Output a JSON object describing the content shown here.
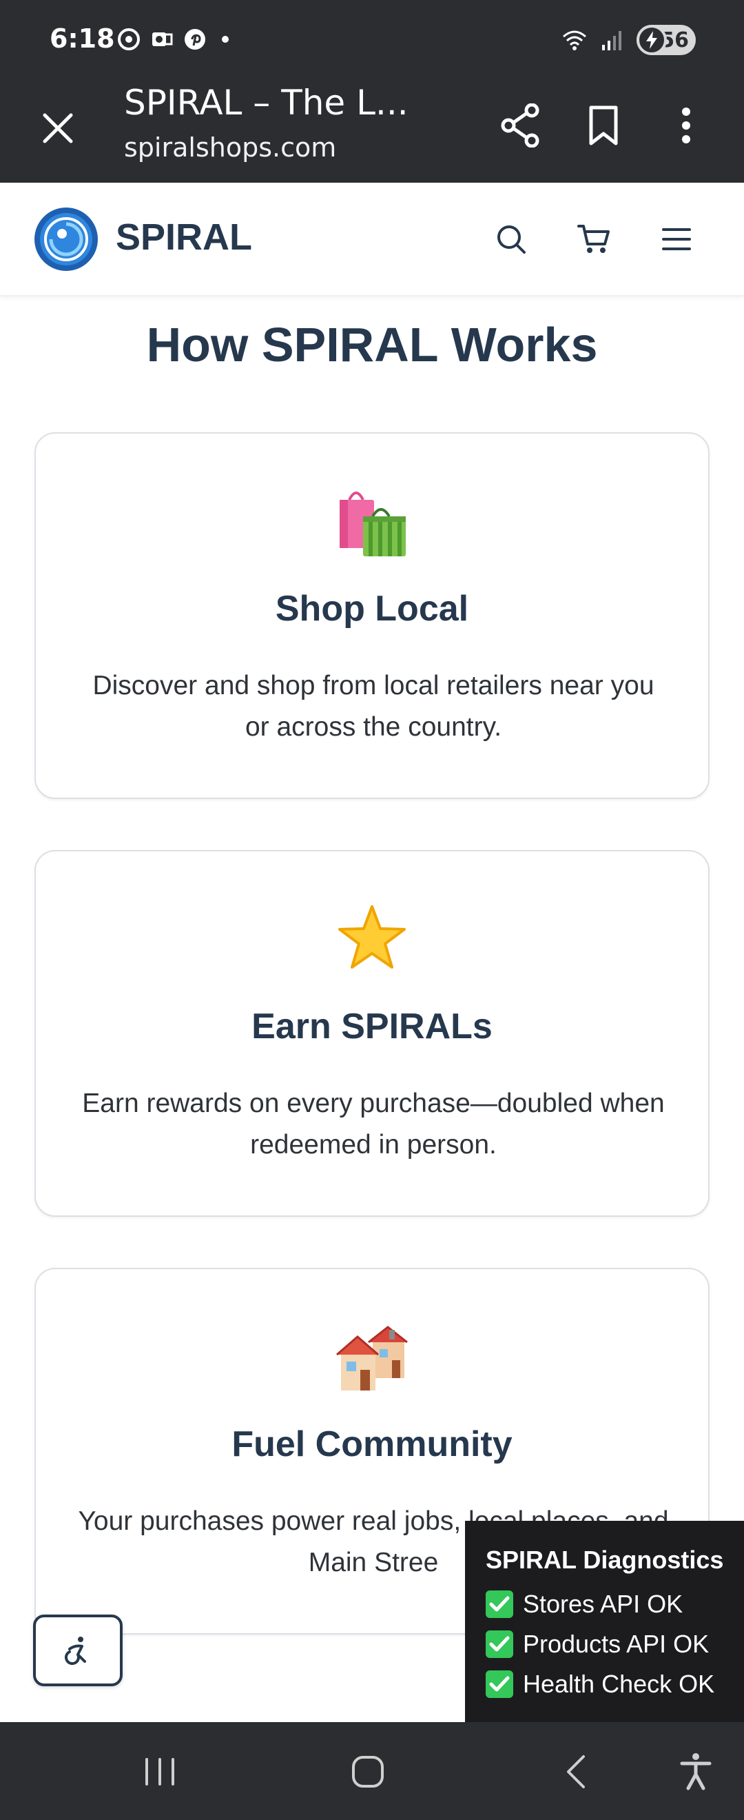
{
  "status_bar": {
    "time": "6:18",
    "battery_level": "56",
    "notification_icons": [
      "chrome-icon",
      "outlook-icon",
      "pinterest-icon"
    ]
  },
  "browser": {
    "title": "SPIRAL – The L...",
    "url": "spiralshops.com"
  },
  "header": {
    "brand": "SPIRAL"
  },
  "main": {
    "title": "How SPIRAL Works",
    "cards": [
      {
        "icon": "shopping-bags",
        "title": "Shop Local",
        "description": "Discover and shop from local retailers near you or across the country."
      },
      {
        "icon": "star",
        "title": "Earn SPIRALs",
        "description": "Earn rewards on every purchase—doubled when redeemed in person."
      },
      {
        "icon": "houses",
        "title": "Fuel Community",
        "description": "Your purchases power real jobs, local places, and Main Stree"
      }
    ]
  },
  "diagnostics": {
    "title": "SPIRAL Diagnostics",
    "items": [
      "Stores API OK",
      "Products API OK",
      "Health Check OK"
    ]
  },
  "colors": {
    "heading": "#26384d",
    "system_bar": "#2c2d30",
    "check_green": "#34c759"
  }
}
